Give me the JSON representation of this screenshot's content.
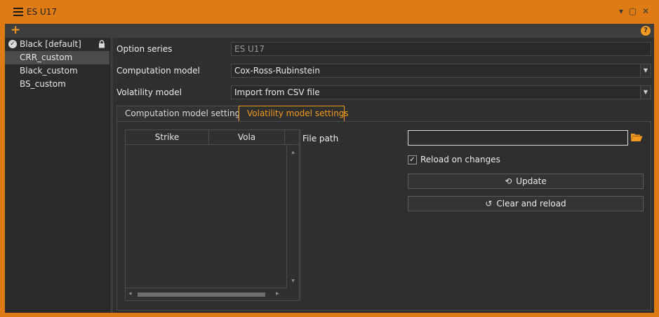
{
  "window": {
    "title": "ES U17",
    "controls": "▾ ▢ ✕"
  },
  "toolbar": {
    "add_icon": "+",
    "help_icon": "?"
  },
  "sidebar": {
    "items": [
      {
        "label": "Black [default]",
        "checked": true,
        "locked": true
      },
      {
        "label": "CRR_custom",
        "selected": true
      },
      {
        "label": "Black_custom"
      },
      {
        "label": "BS_custom"
      }
    ]
  },
  "form": {
    "option_series": {
      "label": "Option series",
      "value": "ES U17"
    },
    "computation_model": {
      "label": "Computation model",
      "value": "Cox-Ross-Rubinstein"
    },
    "volatility_model": {
      "label": "Volatility model",
      "value": "Import from CSV file"
    }
  },
  "tabs": [
    {
      "label": "Computation model settings",
      "active": false
    },
    {
      "label": "Volatility model settings",
      "active": true
    }
  ],
  "vola_table": {
    "columns": [
      "Strike",
      "Vola"
    ],
    "rows": []
  },
  "volatility_settings": {
    "file_path_label": "File path",
    "file_path_value": "",
    "reload_on_changes_label": "Reload on changes",
    "reload_on_changes_checked": true,
    "update_label": "Update",
    "clear_reload_label": "Clear and reload"
  },
  "colors": {
    "accent": "#f39a1d",
    "frame": "#de7b12",
    "background": "#2f2f2f"
  }
}
